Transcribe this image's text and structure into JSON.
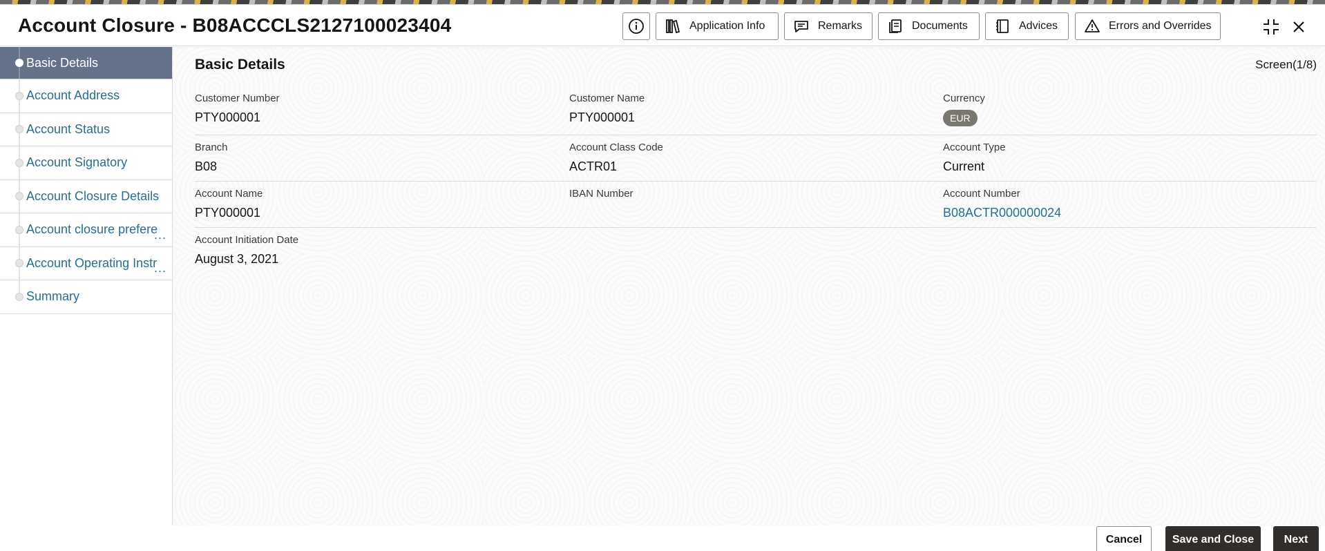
{
  "header": {
    "title": "Account Closure - B08ACCCLS2127100023404",
    "buttons": {
      "info": "",
      "application_info": "Application Info",
      "remarks": "Remarks",
      "documents": "Documents",
      "advices": "Advices",
      "errors": "Errors and Overrides"
    }
  },
  "sidebar": {
    "items": [
      {
        "label": "Basic Details",
        "active": true
      },
      {
        "label": "Account Address"
      },
      {
        "label": "Account Status"
      },
      {
        "label": "Account Signatory"
      },
      {
        "label": "Account Closure Details"
      },
      {
        "label": "Account closure prefere",
        "truncated": "..."
      },
      {
        "label": "Account Operating Instr",
        "truncated": "..."
      },
      {
        "label": "Summary"
      }
    ]
  },
  "main": {
    "title": "Basic Details",
    "screen": "Screen(1/8)",
    "fields": {
      "customer_number": {
        "label": "Customer Number",
        "value": "PTY000001"
      },
      "customer_name": {
        "label": "Customer Name",
        "value": "PTY000001"
      },
      "currency": {
        "label": "Currency",
        "value": "EUR"
      },
      "branch": {
        "label": "Branch",
        "value": "B08"
      },
      "account_class_code": {
        "label": "Account Class Code",
        "value": "ACTR01"
      },
      "account_type": {
        "label": "Account Type",
        "value": "Current"
      },
      "account_name": {
        "label": "Account Name",
        "value": "PTY000001"
      },
      "iban_number": {
        "label": "IBAN Number",
        "value": ""
      },
      "account_number": {
        "label": "Account Number",
        "value": "B08ACTR000000024"
      },
      "initiation_date": {
        "label": "Account Initiation Date",
        "value": "August 3, 2021"
      }
    }
  },
  "footer": {
    "cancel": "Cancel",
    "save_close": "Save and Close",
    "next": "Next"
  },
  "colors": {
    "accent_link": "#227096",
    "active_nav": "#66728a",
    "primary_button": "#312d2a"
  }
}
